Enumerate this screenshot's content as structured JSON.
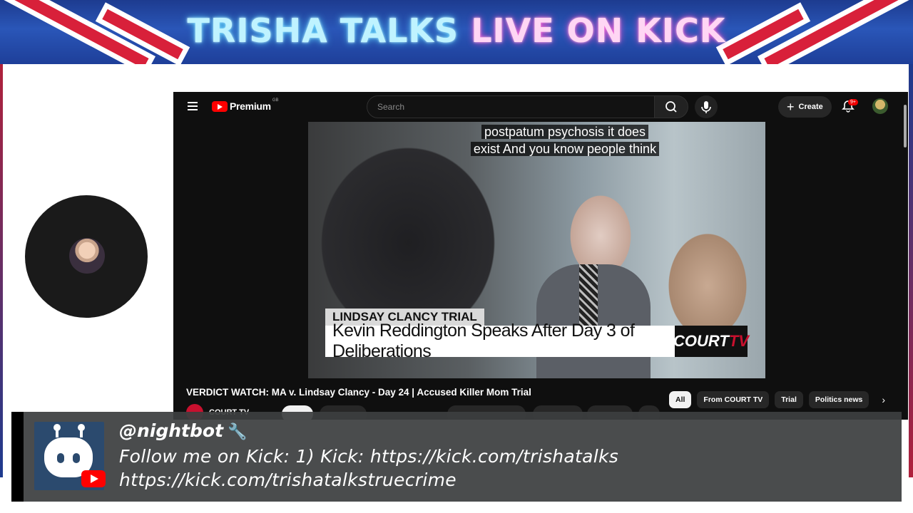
{
  "banner": {
    "title_part1": "TRISHA TALKS",
    "title_part2": "LIVE ON KICK"
  },
  "youtube": {
    "logo_text": "Premium",
    "logo_region": "GB",
    "search_placeholder": "Search",
    "create_label": "Create",
    "notifications_badge": "9+",
    "video": {
      "caption_line1": "postpatum psychosis it does",
      "caption_line2": "exist And you know people think",
      "lower_third_tag": "LINDSAY CLANCY TRIAL",
      "lower_third_headline": "Kevin Reddington Speaks After Day 3 of Deliberations",
      "network_logo_a": "COURT",
      "network_logo_b": "TV"
    },
    "video_title": "VERDICT WATCH: MA v. Lindsay Clancy - Day 24 | Accused Killer Mom Trial",
    "channel_name": "COURT TV",
    "chips": [
      "All",
      "From COURT TV",
      "Trial",
      "Politics news"
    ]
  },
  "nightbot": {
    "username": "@nightbot",
    "message_line1": "Follow me on Kick: 1) Kick: https://kick.com/trishatalks",
    "message_line2": "https://kick.com/trishatalkstruecrime"
  },
  "icons": [
    "hamburger-icon",
    "youtube-play-icon",
    "search-icon",
    "mic-icon",
    "plus-icon",
    "bell-icon",
    "chevron-right-icon",
    "wrench-icon",
    "nightbot-icon",
    "youtube-badge-icon"
  ],
  "colors": {
    "youtube_red": "#ff0000",
    "banner_blue": "#1d3b8f",
    "banner_red": "#d8203a",
    "court_tv_red": "#c8102e"
  }
}
